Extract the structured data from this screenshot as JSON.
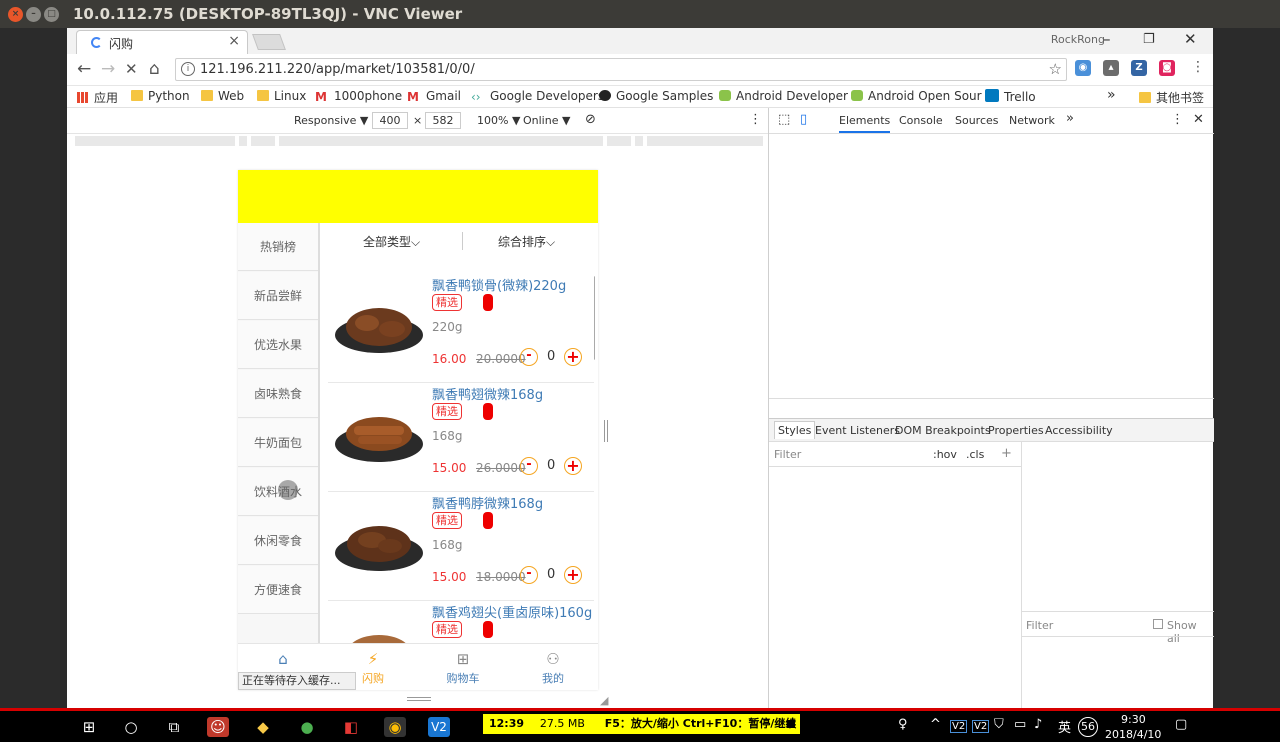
{
  "vnc": {
    "title": "10.0.112.75 (DESKTOP-89TL3QJ) - VNC Viewer"
  },
  "browser": {
    "tab_title": "闪购",
    "profile": "RockRong",
    "url": "121.196.211.220/app/market/103581/0/0/",
    "bookmarks": [
      "应用",
      "Python",
      "Web",
      "Linux",
      "1000phone",
      "Gmail",
      "Google Developers",
      "Google Samples",
      "Android Developer",
      "Android Open Sour",
      "Trello",
      "其他书签"
    ],
    "overflow": "»"
  },
  "device_toolbar": {
    "mode": "Responsive ▼",
    "width": "400",
    "height": "582",
    "times": "×",
    "zoom": "100% ▼",
    "network": "Online ▼"
  },
  "devtools": {
    "tabs": [
      "Elements",
      "Console",
      "Sources",
      "Network"
    ],
    "more": "»",
    "panel_tabs": [
      "Styles",
      "Event Listeners",
      "DOM Breakpoints",
      "Properties",
      "Accessibility"
    ],
    "filter": "Filter",
    "hov": ":hov",
    "cls": ".cls",
    "plus": "+",
    "filter2": "Filter",
    "show_all": "Show all"
  },
  "page": {
    "categories": [
      "热销榜",
      "新品尝鲜",
      "优选水果",
      "卤味熟食",
      "牛奶面包",
      "饮料酒水",
      "休闲零食",
      "方便速食"
    ],
    "sort_type": "全部类型",
    "sort_order": "综合排序",
    "products": [
      {
        "name": "飘香鸭锁骨(微辣)220g",
        "tag": "精选",
        "weight": "220g",
        "price": "16.00",
        "old_price": "20.0000",
        "qty": "0"
      },
      {
        "name": "飘香鸭翅微辣168g",
        "tag": "精选",
        "weight": "168g",
        "price": "15.00",
        "old_price": "26.0000",
        "qty": "0"
      },
      {
        "name": "飘香鸭脖微辣168g",
        "tag": "精选",
        "weight": "168g",
        "price": "15.00",
        "old_price": "18.0000",
        "qty": "0"
      },
      {
        "name": "飘香鸡翅尖(重卤原味)160g",
        "tag": "精选",
        "weight": "",
        "price": "",
        "old_price": "",
        "qty": ""
      }
    ],
    "tabbar": [
      "首页",
      "闪购",
      "购物车",
      "我的"
    ],
    "active_tab_color": "#f5a623",
    "status": "正在等待存入缓存..."
  },
  "taskbar": {
    "vnc_time": "12:39",
    "vnc_mem": "27.5 MB",
    "vnc_hint": "F5：放大/缩小 Ctrl+F10：暂停/继续",
    "ime": "英",
    "counter": "56",
    "time": "9:30",
    "date": "2018/4/10"
  }
}
